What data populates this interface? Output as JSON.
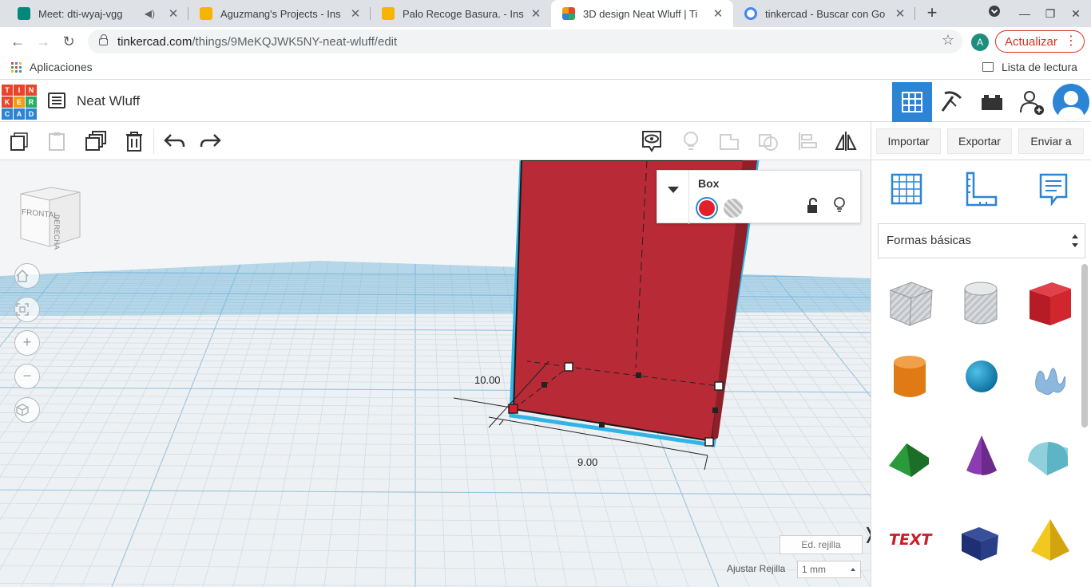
{
  "browser": {
    "tabs": [
      {
        "title": "Meet: dti-wyaj-vgg",
        "favicon_color": "#00897b"
      },
      {
        "title": "Aguzmang's Projects - Ins",
        "favicon_color": "#f4b400"
      },
      {
        "title": "Palo Recoge Basura. - Ins",
        "favicon_color": "#f4b400"
      },
      {
        "title": "3D design Neat Wluff | Ti",
        "favicon_color": "#e8452c"
      },
      {
        "title": "tinkercad - Buscar con Go",
        "favicon_color": "#4285f4"
      }
    ],
    "url_host": "tinkercad.com",
    "url_path": "/things/9MeKQJWK5NY-neat-wluff/edit",
    "profile_initial": "A",
    "update_label": "Actualizar",
    "bookmarks_apps": "Aplicaciones",
    "reading_list": "Lista de lectura"
  },
  "app": {
    "logo_letters": [
      "T",
      "I",
      "N",
      "K",
      "E",
      "R",
      "C",
      "A",
      "D"
    ],
    "logo_colors": [
      "#e8452c",
      "#e8452c",
      "#e8452c",
      "#e8452c",
      "#f39c12",
      "#27ae60",
      "#2c84d4",
      "#2c84d4",
      "#2c84d4"
    ],
    "design_name": "Neat Wluff",
    "accent_color": "#2c84d4"
  },
  "toolbar": {
    "import_label": "Importar",
    "export_label": "Exportar",
    "send_label": "Enviar a"
  },
  "inspector": {
    "shape_name": "Box",
    "solid_color": "#e0202a"
  },
  "viewport": {
    "viewcube_front": "FRONTAL",
    "viewcube_right": "DERECHA",
    "dim_width": "9.00",
    "dim_depth": "10.00",
    "grid_edit_label": "Ed. rejilla",
    "snap_label": "Ajustar Rejilla",
    "snap_value": "1 mm"
  },
  "panel": {
    "library": "Formas básicas",
    "shapes": [
      "box-hole",
      "cylinder-hole",
      "box",
      "cylinder",
      "sphere",
      "scribble",
      "roof",
      "cone",
      "round-roof",
      "text",
      "wedge",
      "pyramid"
    ]
  }
}
